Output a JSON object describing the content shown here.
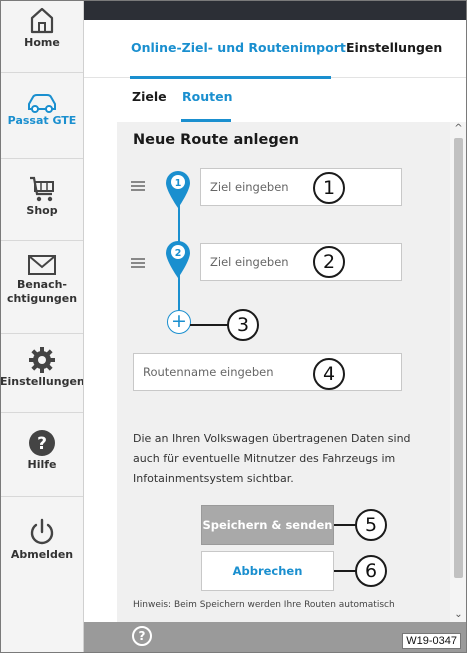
{
  "sidebar": {
    "items": [
      {
        "label": "Home",
        "icon": "home-icon"
      },
      {
        "label": "Passat GTE",
        "icon": "car-icon"
      },
      {
        "label": "Shop",
        "icon": "cart-icon"
      },
      {
        "label": "Benach-\nchtigungen",
        "icon": "mail-icon"
      },
      {
        "label": "Einstellungen",
        "icon": "gear-icon"
      },
      {
        "label": "Hilfe",
        "icon": "help-icon"
      },
      {
        "label": "Abmelden",
        "icon": "power-icon"
      }
    ]
  },
  "nav": {
    "tabs": [
      {
        "label": "Online-Ziel- und Routenimport",
        "active": true
      },
      {
        "label": "Einstellungen",
        "active": false
      }
    ]
  },
  "subtabs": [
    {
      "label": "Ziele",
      "active": false
    },
    {
      "label": "Routen",
      "active": true
    }
  ],
  "form": {
    "title": "Neue Route anlegen",
    "waypoints": [
      {
        "number": "1",
        "placeholder": "Ziel eingeben"
      },
      {
        "number": "2",
        "placeholder": "Ziel eingeben"
      }
    ],
    "add_symbol": "+",
    "route_name_placeholder": "Routenname eingeben",
    "info_text": "Die an Ihren Volkswagen übertragenen Daten sind auch für eventuelle Mitnutzer des Fahrzeugs im Infotainmentsystem sichtbar.",
    "save_label": "Speichern & senden",
    "cancel_label": "Abbrechen",
    "hint": "Hinweis: Beim Speichern werden Ihre Routen automatisch"
  },
  "callouts": [
    "1",
    "2",
    "3",
    "4",
    "5",
    "6"
  ],
  "bottom": {
    "help_symbol": "?",
    "figure_ref": "W19-0347"
  },
  "colors": {
    "accent": "#1a8fcf",
    "topbar": "#2c2f36",
    "save_disabled": "#a9a9a9",
    "bottombar": "#9a9a9a"
  }
}
